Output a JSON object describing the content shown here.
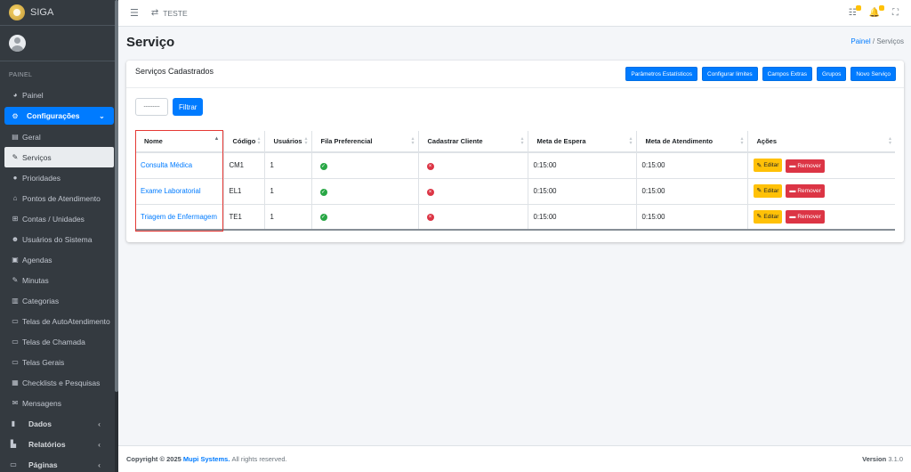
{
  "app": {
    "name": "SIGA"
  },
  "sidebar": {
    "header": "PAINEL",
    "items": [
      {
        "icon": "tachometer-icon",
        "glyph": "◕",
        "label": "Painel"
      },
      {
        "icon": "cogs-icon",
        "glyph": "⚙",
        "label": "Configurações"
      },
      {
        "icon": "print-icon",
        "glyph": "▤",
        "label": "Geral"
      },
      {
        "icon": "wrench-icon",
        "glyph": "✎",
        "label": "Serviços"
      },
      {
        "icon": "priority-icon",
        "glyph": "●",
        "label": "Prioridades"
      },
      {
        "icon": "home-icon",
        "glyph": "⌂",
        "label": "Pontos de Atendimento"
      },
      {
        "icon": "sitemap-icon",
        "glyph": "⊞",
        "label": "Contas / Unidades"
      },
      {
        "icon": "users-icon",
        "glyph": "☻",
        "label": "Usuários do Sistema"
      },
      {
        "icon": "address-book-icon",
        "glyph": "▣",
        "label": "Agendas"
      },
      {
        "icon": "edit-icon",
        "glyph": "✎",
        "label": "Minutas"
      },
      {
        "icon": "archive-icon",
        "glyph": "▥",
        "label": "Categorias"
      },
      {
        "icon": "desktop-icon",
        "glyph": "▭",
        "label": "Telas de AutoAtendimento"
      },
      {
        "icon": "desktop-icon",
        "glyph": "▭",
        "label": "Telas de Chamada"
      },
      {
        "icon": "desktop-icon",
        "glyph": "▭",
        "label": "Telas Gerais"
      },
      {
        "icon": "checklist-icon",
        "glyph": "▦",
        "label": "Checklists e Pesquisas"
      },
      {
        "icon": "envelope-icon",
        "glyph": "✉",
        "label": "Mensagens"
      },
      {
        "icon": "database-icon",
        "glyph": "▮",
        "label": "Dados"
      },
      {
        "icon": "chart-icon",
        "glyph": "▙",
        "label": "Relatórios"
      },
      {
        "icon": "desktop-icon",
        "glyph": "▭",
        "label": "Páginas"
      }
    ]
  },
  "topbar": {
    "env_label": "TESTE"
  },
  "page": {
    "title": "Serviço"
  },
  "breadcrumb": {
    "home": "Painel",
    "separator": "/",
    "current": "Serviços"
  },
  "card": {
    "title": "Serviços Cadastrados",
    "tools": [
      "Parâmetros Estatísticos",
      "Configurar limites",
      "Campos Extras",
      "Grupos",
      "Novo Serviço"
    ],
    "filter_select": "---------",
    "filter_button": "Filtrar"
  },
  "table": {
    "headers": [
      "Nome",
      "Código",
      "Usuários",
      "Fila Preferencial",
      "Cadastrar Cliente",
      "Meta de Espera",
      "Meta de Atendimento",
      "Ações"
    ],
    "rows": [
      {
        "nome": "Consulta Médica",
        "codigo": "CM1",
        "usuarios": "1",
        "fila_preferencial": true,
        "cadastrar_cliente": false,
        "meta_espera": "0:15:00",
        "meta_atendimento": "0:15:00"
      },
      {
        "nome": "Exame Laboratorial",
        "codigo": "EL1",
        "usuarios": "1",
        "fila_preferencial": true,
        "cadastrar_cliente": false,
        "meta_espera": "0:15:00",
        "meta_atendimento": "0:15:00"
      },
      {
        "nome": "Triagem de Enfermagem",
        "codigo": "TE1",
        "usuarios": "1",
        "fila_preferencial": true,
        "cadastrar_cliente": false,
        "meta_espera": "0:15:00",
        "meta_atendimento": "0:15:00"
      }
    ],
    "edit_label": "Editar",
    "remove_label": "Remover"
  },
  "footer": {
    "copyright_prefix": "Copyright © 2025",
    "company": "Mupi Systems.",
    "rights": "All rights reserved.",
    "version_label": "Version",
    "version": "3.1.0"
  },
  "colors": {
    "primary": "#007bff",
    "sidebar": "#343a40",
    "warning": "#ffc107",
    "danger": "#dc3545",
    "success": "#28a745",
    "highlight": "#e53935"
  }
}
